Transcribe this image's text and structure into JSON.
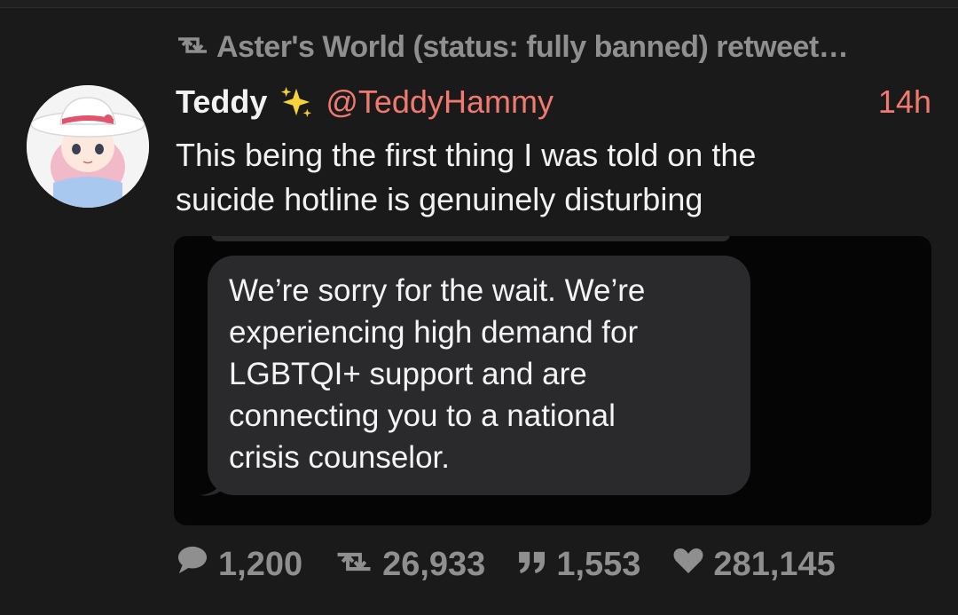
{
  "retweet": {
    "label": "Aster's World (status: fully banned) retweet…"
  },
  "author": {
    "display_name": "Teddy",
    "handle": "@TeddyHammy",
    "timestamp": "14h"
  },
  "tweet": {
    "line1": "This being the first thing I was told on the",
    "line2": "suicide hotline is genuinely disturbing"
  },
  "media": {
    "message_lines": [
      "We’re sorry for the wait. We’re",
      "experiencing high demand for",
      "LGBTQI+ support and are",
      "connecting you to a national",
      "crisis counselor."
    ]
  },
  "stats": {
    "replies": "1,200",
    "retweets": "26,933",
    "quotes": "1,553",
    "likes": "281,145"
  },
  "colors": {
    "accent": "#f07a6f",
    "muted": "#8f8f8f",
    "background": "#1a1a1a",
    "bubble": "#2a2a2d"
  },
  "icons": {
    "retweet": "retweet-icon",
    "reply": "reply-icon",
    "quote": "quote-icon",
    "like": "heart-icon",
    "sparkle": "sparkles-icon"
  }
}
